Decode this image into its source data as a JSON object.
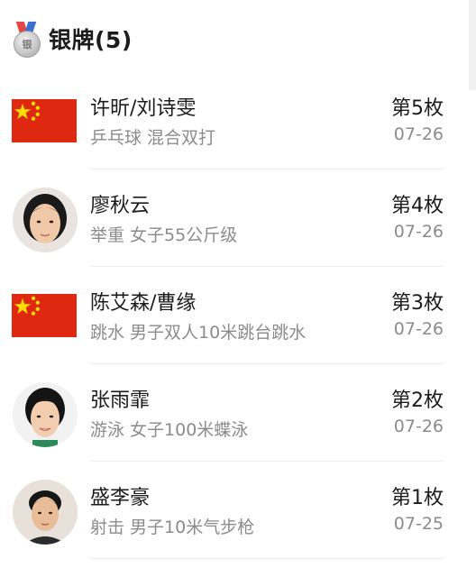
{
  "header": {
    "medal_icon": "silver-medal-icon",
    "medal_text": "银",
    "title": "银牌(5)"
  },
  "entries": [
    {
      "image": "china-flag-icon",
      "name": "许昕/刘诗雯",
      "event": "乒乓球 混合双打",
      "rank": "第5枚",
      "date": "07-26"
    },
    {
      "image": "athlete-photo",
      "name": "廖秋云",
      "event": "举重 女子55公斤级",
      "rank": "第4枚",
      "date": "07-26"
    },
    {
      "image": "china-flag-icon",
      "name": "陈艾森/曹缘",
      "event": "跳水 男子双人10米跳台跳水",
      "rank": "第3枚",
      "date": "07-26"
    },
    {
      "image": "athlete-photo",
      "name": "张雨霏",
      "event": "游泳 女子100米蝶泳",
      "rank": "第2枚",
      "date": "07-26"
    },
    {
      "image": "athlete-photo",
      "name": "盛李豪",
      "event": "射击 男子10米气步枪",
      "rank": "第1枚",
      "date": "07-25"
    }
  ],
  "colors": {
    "flag_red": "#de2910",
    "flag_yellow": "#ffde00",
    "text_primary": "#1c1c1c",
    "text_secondary": "#8b8b8b"
  }
}
